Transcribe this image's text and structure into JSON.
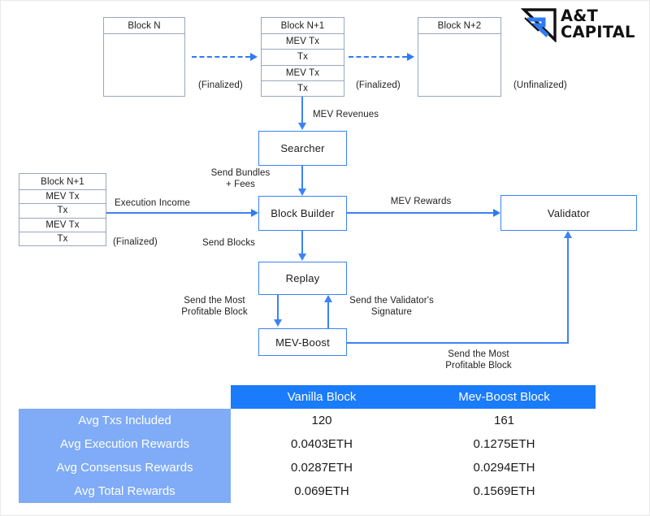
{
  "logo": {
    "mark": "triangle-arrow-mark",
    "line1": "A&T",
    "line2": "CAPITAL"
  },
  "blocks": {
    "block_n": {
      "title": "Block N",
      "rows": [],
      "status": "(Finalized)"
    },
    "block_n1_top": {
      "title": "Block N+1",
      "rows": [
        "MEV Tx",
        "Tx",
        "MEV Tx",
        "Tx"
      ],
      "status": "(Finalized)"
    },
    "block_n2": {
      "title": "Block N+2",
      "rows": [],
      "status": "(Unfinalized)"
    },
    "block_n1_left": {
      "title": "Block N+1",
      "rows": [
        "MEV Tx",
        "Tx",
        "MEV Tx",
        "Tx"
      ],
      "status": "(Finalized)"
    }
  },
  "nodes": {
    "searcher": "Searcher",
    "block_builder": "Block Builder",
    "replay": "Replay",
    "mev_boost": "MEV-Boost",
    "validator": "Validator"
  },
  "edges": {
    "mev_revenues": "MEV Revenues",
    "send_bundles_fees": "Send Bundles\n+ Fees",
    "execution_income": "Execution Income",
    "send_blocks": "Send Blocks",
    "mev_rewards": "MEV Rewards",
    "send_most_profitable_block_left": "Send the Most\nProfitable Block",
    "send_validator_signature": "Send the Validator's\nSignature",
    "send_most_profitable_block_bottom": "Send the Most\nProfitable Block"
  },
  "table": {
    "columns": [
      "",
      "Vanilla Block",
      "Mev-Boost Block"
    ],
    "rows": [
      {
        "label": "Avg Txs Included",
        "vanilla": "120",
        "mevboost": "161"
      },
      {
        "label": "Avg Execution Rewards",
        "vanilla": "0.0403ETH",
        "mevboost": "0.1275ETH"
      },
      {
        "label": "Avg Consensus Rewards",
        "vanilla": "0.0287ETH",
        "mevboost": "0.0294ETH"
      },
      {
        "label": "Avg Total Rewards",
        "vanilla": "0.069ETH",
        "mevboost": "0.1569ETH"
      }
    ]
  },
  "colors": {
    "accent_blue": "#3b82f6",
    "header_blue": "#1a7bfb",
    "row_label_blue": "#7fabf7",
    "block_border": "#9aa6bd"
  }
}
